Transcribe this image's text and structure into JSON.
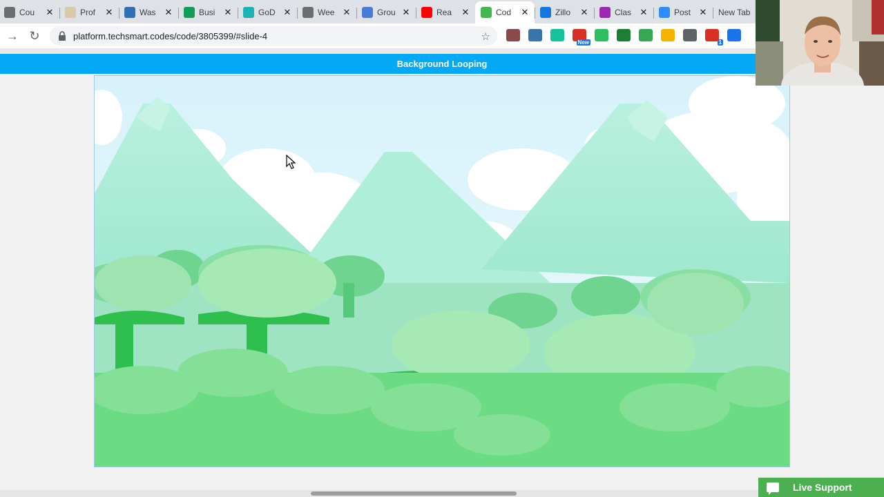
{
  "browser": {
    "tabs": [
      {
        "title": "Cou",
        "icon": "generic-page-icon",
        "color": "#6d6d6d"
      },
      {
        "title": "Prof",
        "icon": "profile-icon",
        "color": "#d9c9a8"
      },
      {
        "title": "Was",
        "icon": "diamond-icon",
        "color": "#2f6fb5"
      },
      {
        "title": "Busi",
        "icon": "sheets-icon",
        "color": "#0f9d58"
      },
      {
        "title": "GoD",
        "icon": "godaddy-icon",
        "color": "#1bb3b3"
      },
      {
        "title": "Wee",
        "icon": "weebly-icon",
        "color": "#6d6d6d"
      },
      {
        "title": "Grou",
        "icon": "mail-icon",
        "color": "#4a7bd4"
      },
      {
        "title": "Rea",
        "icon": "youtube-icon",
        "color": "#ff0000"
      },
      {
        "title": "Cod",
        "icon": "techsmart-icon",
        "color": "#3fb950",
        "active": true
      },
      {
        "title": "Zillo",
        "icon": "zillow-icon",
        "color": "#1277e1"
      },
      {
        "title": "Clas",
        "icon": "classroom-icon",
        "color": "#9c27b0"
      },
      {
        "title": "Post",
        "icon": "zoom-icon",
        "color": "#2d8cff"
      },
      {
        "title": "New Tab",
        "icon": "",
        "color": ""
      }
    ],
    "url": "platform.techsmart.codes/code/3805399/#slide-4",
    "extensions": [
      {
        "name": "pdf-extension-icon",
        "color": "#8b4a4a"
      },
      {
        "name": "python-extension-icon",
        "color": "#3776ab"
      },
      {
        "name": "grammarly-extension-icon",
        "color": "#15c39a"
      },
      {
        "name": "new-extension-icon",
        "color": "#d93025",
        "badge": "New"
      },
      {
        "name": "evernote-extension-icon",
        "color": "#2dbe60"
      },
      {
        "name": "jump-extension-icon",
        "color": "#1e7e34"
      },
      {
        "name": "cast-extension-icon",
        "color": "#34a853"
      },
      {
        "name": "classroom-extension-icon",
        "color": "#f4b400"
      },
      {
        "name": "reader-extension-icon",
        "color": "#5f6368"
      },
      {
        "name": "share-extension-icon",
        "color": "#d93025",
        "badge": "1"
      },
      {
        "name": "puzzle-extension-icon",
        "color": "#1a73e8"
      }
    ]
  },
  "page": {
    "banner_title": "Background Looping",
    "live_support_label": "Live Support"
  },
  "colors": {
    "banner": "#03a9f4",
    "sky": "#dff4fb",
    "mountain": "#a8ecd3",
    "tree_dark": "#2fbf4e",
    "grass": "#6cdc84",
    "live_support": "#4caf50"
  }
}
